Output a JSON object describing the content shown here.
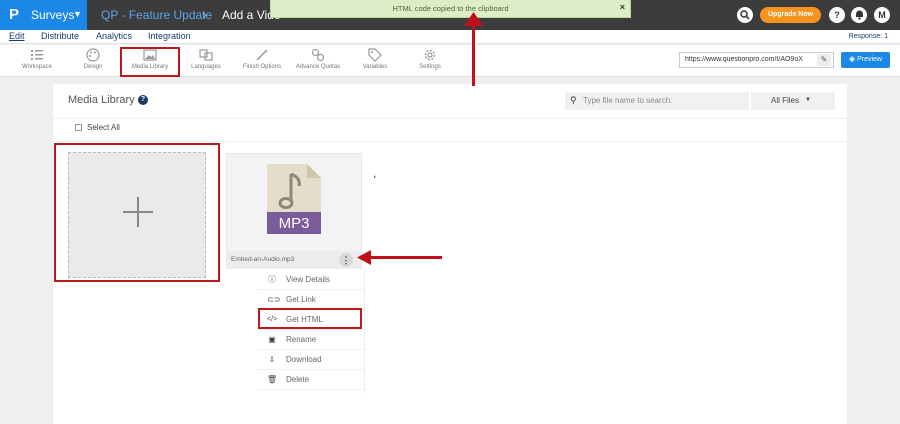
{
  "topbar": {
    "logo": "P",
    "product": "Surveys",
    "breadcrumb_survey": "QP - Feature Update",
    "breadcrumb_page": "Add a Vide",
    "toast": "HTML code copied to the clipboard",
    "toast_close": "×",
    "upgrade": "Upgrade Now",
    "help": "?",
    "avatar": "M"
  },
  "menubar": {
    "items": [
      "Edit",
      "Distribute",
      "Analytics",
      "Integration"
    ],
    "response": "Response: 1"
  },
  "toolbar": {
    "tools": [
      {
        "label": "Workspace",
        "icon": "workspace-icon"
      },
      {
        "label": "Design",
        "icon": "palette-icon"
      },
      {
        "label": "Media Library",
        "icon": "image-icon"
      },
      {
        "label": "Languages",
        "icon": "translate-icon"
      },
      {
        "label": "Finish Options",
        "icon": "magic-wand-icon"
      },
      {
        "label": "Advance Quotas",
        "icon": "quota-icon"
      },
      {
        "label": "Variables",
        "icon": "tag-icon"
      },
      {
        "label": "Settings",
        "icon": "gear-icon"
      }
    ],
    "survey_url": "https://www.questionpro.com/t/AO9oX",
    "preview": "Preview"
  },
  "media_library": {
    "title": "Media Library",
    "search_placeholder": "Type file name to search.",
    "filter": "All Files",
    "select_all": "Select All",
    "file": {
      "type": "MP3",
      "name": "Embed-an-Audio.mp3"
    },
    "context_menu": [
      "View Details",
      "Get Link",
      "Get HTML",
      "Rename",
      "Download",
      "Delete"
    ]
  },
  "colors": {
    "brand": "#1b87e6",
    "topbar": "#3c3c3c",
    "upgrade": "#f7941d",
    "annotation": "#b71c1c",
    "mp3_label": "#7a5c9a"
  }
}
